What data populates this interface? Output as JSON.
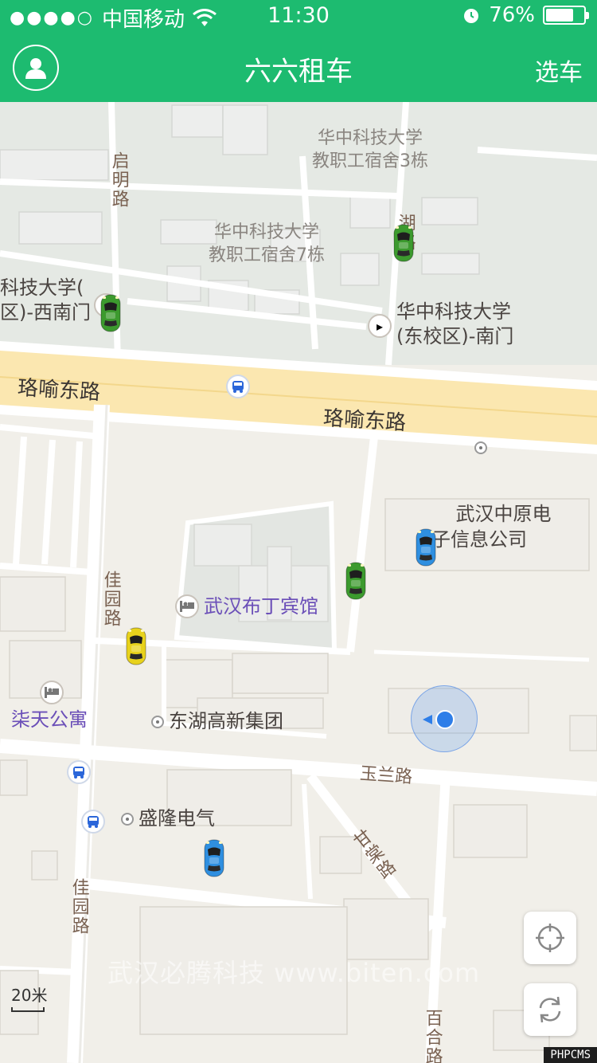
{
  "status_bar": {
    "signal": "●●●●○",
    "carrier": "中国移动",
    "time": "11:30",
    "battery_text": "76%",
    "battery_level": 0.76
  },
  "nav": {
    "title": "六六租车",
    "right_action": "选车",
    "left_icon": "user-icon"
  },
  "map": {
    "road_labels": {
      "qiming": "启明路",
      "hu": "湖路",
      "luoyu_west": "珞喻东路",
      "luoyu_east": "珞喻东路",
      "jiayuan_top": "佳园路",
      "jiayuan_bottom": "佳园路",
      "yulan": "玉兰路",
      "gantan": "甘棠路",
      "baihe": "百合路"
    },
    "pois": {
      "dorm3": "华中科技大学\n教职工宿舍3栋",
      "dorm7": "华中科技大学\n教职工宿舍7栋",
      "west_gate": "科技大学(\n区)-西南门",
      "south_gate": "华中科技大学\n(东校区)-南门",
      "zhongyuan": "武汉中原电\n子信息公司",
      "hotel": "武汉布丁宾馆",
      "apartment": "柒天公寓",
      "donghu": "东湖高新集团",
      "shenglong": "盛隆电气"
    },
    "scale_label": "20米",
    "watermark": "武汉必腾科技 www.biten.com",
    "corner_tag": "PHPCMS"
  },
  "cars": [
    {
      "color": "green"
    },
    {
      "color": "green"
    },
    {
      "color": "blue"
    },
    {
      "color": "green"
    },
    {
      "color": "yellow"
    },
    {
      "color": "blue"
    }
  ],
  "colors": {
    "brand": "#1dbb70",
    "car_green": "#3c9a2e",
    "car_blue": "#2f8fe0",
    "car_yellow": "#e8d21c"
  }
}
